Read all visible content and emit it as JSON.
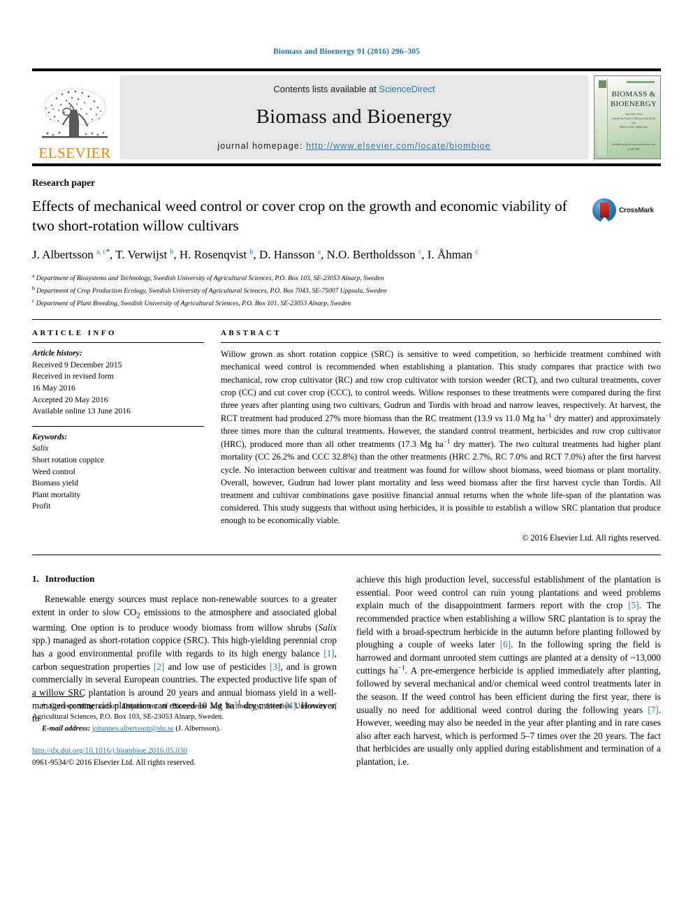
{
  "running_head": "Biomass and Bioenergy 91 (2016) 296–305",
  "masthead": {
    "contents_prefix": "Contents lists available at ",
    "sciencedirect": "ScienceDirect",
    "journal_name": "Biomass and Bioenergy",
    "homepage_label": "journal homepage: ",
    "homepage_url": "http://www.elsevier.com/locate/biombioe",
    "publisher": "ELSEVIER",
    "cover": {
      "title_line1": "BIOMASS &",
      "title_line2": "BIOENERGY",
      "issn_line": "ISSN 0961-9534",
      "sub_line1": "Founded by David O. Hall and Chin Ku Ko Liao",
      "sub_line2": "Editor-in-Chief: Ralph Sims",
      "bottom1": "Available online at www.sciencedirect.com",
      "bottom2": "ELSEVIER"
    }
  },
  "article": {
    "type": "Research paper",
    "title": "Effects of mechanical weed control or cover crop on the growth and economic viability of two short-rotation willow cultivars",
    "crossmark_label": "CrossMark",
    "authors": [
      {
        "name": "J. Albertsson",
        "sup": "a, c",
        "star": true
      },
      {
        "name": "T. Verwijst",
        "sup": "b"
      },
      {
        "name": "H. Rosenqvist",
        "sup": "b"
      },
      {
        "name": "D. Hansson",
        "sup": "a"
      },
      {
        "name": "N.O. Bertholdsson",
        "sup": "c"
      },
      {
        "name": "I. Åhman",
        "sup": "c"
      }
    ],
    "affiliations": [
      {
        "mark": "a",
        "text": "Department of Biosystems and Technology, Swedish University of Agricultural Sciences, P.O. Box 103, SE-23053 Alnarp, Sweden"
      },
      {
        "mark": "b",
        "text": "Department of Crop Production Ecology, Swedish University of Agricultural Sciences, P.O. Box 7043, SE-75007 Uppsala, Sweden"
      },
      {
        "mark": "c",
        "text": "Department of Plant Breeding, Swedish University of Agricultural Sciences, P.O. Box 101, SE-23053 Alnarp, Sweden"
      }
    ]
  },
  "article_info": {
    "heading": "ARTICLE INFO",
    "history_label": "Article history:",
    "history": [
      "Received 9 December 2015",
      "Received in revised form",
      "16 May 2016",
      "Accepted 20 May 2016",
      "Available online 13 June 2016"
    ],
    "keywords_label": "Keywords:",
    "keywords": [
      "Salix",
      "Short rotation coppice",
      "Weed control",
      "Biomass yield",
      "Plant mortality",
      "Profit"
    ]
  },
  "abstract": {
    "heading": "ABSTRACT",
    "body": "Willow grown as short rotation coppice (SRC) is sensitive to weed competition, so herbicide treatment combined with mechanical weed control is recommended when establishing a plantation. This study compares that practice with two mechanical, row crop cultivator (RC) and row crop cultivator with torsion weeder (RCT), and two cultural treatments, cover crop (CC) and cut cover crop (CCC), to control weeds. Willow responses to these treatments were compared during the first three years after planting using two cultivars, Gudrun and Tordis with broad and narrow leaves, respectively. At harvest, the RCT treatment had produced 27% more biomass than the RC treatment (13.9 vs 11.0 Mg ha−1 dry matter) and approximately three times more than the cultural treatments. However, the standard control treatment, herbicides and row crop cultivator (HRC), produced more than all other treatments (17.3 Mg ha−1 dry matter). The two cultural treatments had higher plant mortality (CC 26.2% and CCC 32.8%) than the other treatments (HRC 2.7%, RC 7.0% and RCT 7.0%) after the first harvest cycle. No interaction between cultivar and treatment was found for willow shoot biomass, weed biomass or plant mortality. Overall, however, Gudrun had lower plant mortality and less weed biomass after the first harvest cycle than Tordis. All treatment and cultivar combinations gave positive financial annual returns when the whole life-span of the plantation was considered. This study suggests that without using herbicides, it is possible to establish a willow SRC plantation that produce enough to be economically viable.",
    "copyright": "© 2016 Elsevier Ltd. All rights reserved."
  },
  "introduction": {
    "number": "1.",
    "title": "Introduction",
    "left_paragraph": "Renewable energy sources must replace non-renewable sources to a greater extent in order to slow CO2 emissions to the atmosphere and associated global warming. One option is to produce woody biomass from willow shrubs (Salix spp.) managed as short-rotation coppice (SRC). This high-yielding perennial crop has a good environmental profile with regards to its high energy balance [1], carbon sequestration properties [2] and low use of pesticides [3], and is grown commercially in several European countries. The expected productive life span of a willow SRC plantation is around 20 years and annual biomass yield in a well-managed commercial plantation can exceed 10 Mg ha−1 dry matter [4]. However, to",
    "right_paragraph": "achieve this high production level, successful establishment of the plantation is essential. Poor weed control can ruin young plantations and weed problems explain much of the disappointment farmers report with the crop [5]. The recommended practice when establishing a willow SRC plantation is to spray the field with a broad-spectrum herbicide in the autumn before planting followed by ploughing a couple of weeks later [6]. In the following spring the field is harrowed and dormant unrooted stem cuttings are planted at a density of ~13,000 cuttings ha−1. A pre-emergence herbicide is applied immediately after planting, followed by several mechanical and/or chemical weed control treatments later in the season. If the weed control has been efficient during the first year, there is usually no need for additional weed control during the following years [7]. However, weeding may also be needed in the year after planting and in rare cases also after each harvest, which is performed 5–7 times over the 20 years. The fact that herbicides are usually only applied during establishment and termination of a plantation, i.e."
  },
  "footnote": {
    "star": "*",
    "corresponding": "Corresponding author. Department of Biosystems and Technology, Swedish University of Agricultural Sciences, P.O. Box 103, SE-23053 Alnarp, Sweden.",
    "email_label": "E-mail address:",
    "email": "johannes.albertsson@slu.se",
    "email_suffix": "(J. Albertsson)."
  },
  "doi_block": {
    "doi": "http://dx.doi.org/10.1016/j.biombioe.2016.05.030",
    "issn_line": "0961-9534/© 2016 Elsevier Ltd. All rights reserved."
  },
  "colors": {
    "link_blue": "#2a7ab0",
    "running_head_blue": "#1a74a8",
    "elsevier_orange": "#ef8200",
    "masthead_gray": "#e6e6e6"
  }
}
